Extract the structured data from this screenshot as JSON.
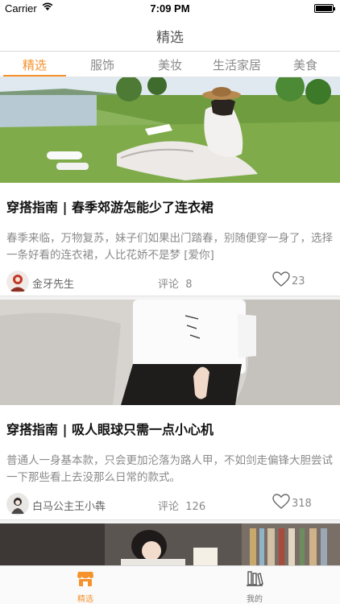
{
  "status_bar": {
    "carrier": "Carrier",
    "time": "7:09 PM"
  },
  "nav": {
    "title": "精选"
  },
  "tabs": [
    {
      "label": "精选"
    },
    {
      "label": "服饰"
    },
    {
      "label": "美妆"
    },
    {
      "label": "生活家居"
    },
    {
      "label": "美食"
    }
  ],
  "articles": [
    {
      "title": "穿搭指南 | 春季郊游怎能少了连衣裙",
      "summary": "春季来临，万物复苏，妹子们如果出门踏春，别随便穿一身了，选择一条好看的连衣裙，人比花娇不是梦 [爱你]",
      "author": "金牙先生",
      "comment_label": "评论",
      "comment_count": "8",
      "likes": "23"
    },
    {
      "title": "穿搭指南 | 吸人眼球只需一点小心机",
      "summary": "普通人一身基本款，只会更加沦落为路人甲，不如剑走偏锋大胆尝试一下那些看上去没那么日常的款式。",
      "author": "白马公主王小犇",
      "comment_label": "评论",
      "comment_count": "126",
      "likes": "318"
    }
  ],
  "tab_bar": [
    {
      "label": "精选"
    },
    {
      "label": "我的"
    }
  ],
  "colors": {
    "accent": "#f5922c"
  }
}
